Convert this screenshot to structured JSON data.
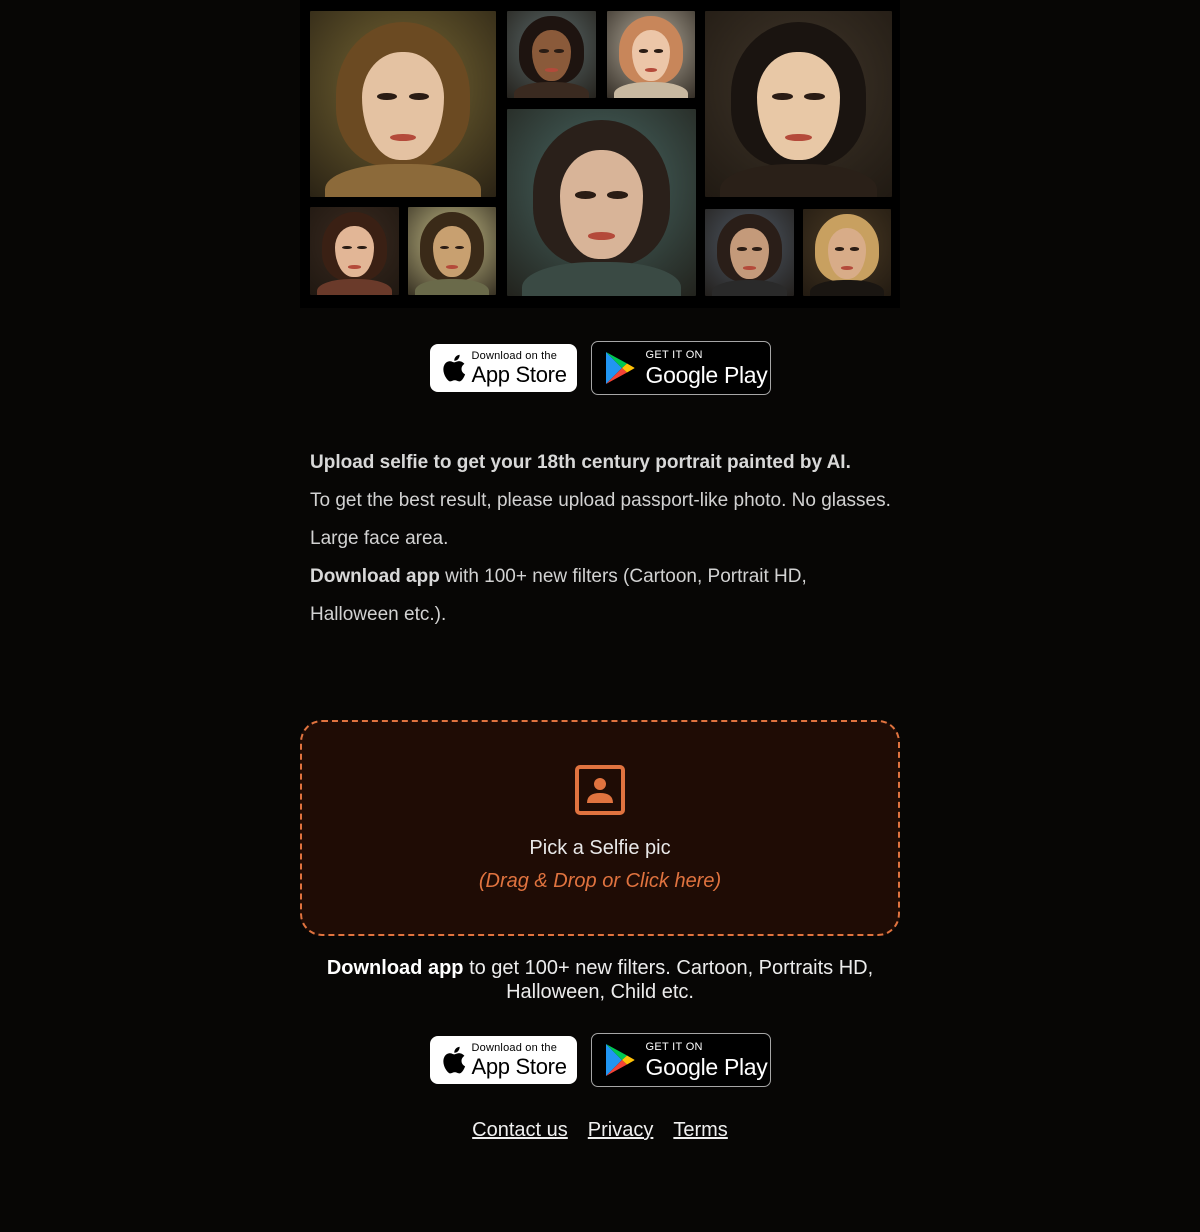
{
  "collage": {
    "portraits": [
      {
        "name": "portrait-woman-auburn-hair",
        "skin": "#e4c2a2",
        "hair": "#6b4a22",
        "bg": "#7a6a35",
        "clothes": "#8c6a3a"
      },
      {
        "name": "portrait-woman-dark-stylized",
        "skin": "#8a5a3a",
        "hair": "#1e1410",
        "bg": "#5c6a6a",
        "clothes": "#3a2a20"
      },
      {
        "name": "portrait-girl-blonde",
        "skin": "#ecc6a8",
        "hair": "#c8865a",
        "bg": "#b8b0a0",
        "clothes": "#c8b8a0"
      },
      {
        "name": "portrait-woman-black-hair",
        "skin": "#e8c8a6",
        "hair": "#1a1410",
        "bg": "#40362a",
        "clothes": "#2a2018"
      },
      {
        "name": "portrait-girl-teal-background",
        "skin": "#d8b498",
        "hair": "#2a201a",
        "bg": "#4a6a66",
        "clothes": "#3a4a44"
      },
      {
        "name": "portrait-woman-brunette-updo",
        "skin": "#e2b696",
        "hair": "#3a2014",
        "bg": "#3a2a20",
        "clothes": "#6a3a2a"
      },
      {
        "name": "portrait-woman-bob-hair",
        "skin": "#c8a070",
        "hair": "#3a2a18",
        "bg": "#c8c08a",
        "clothes": "#6a6a4a"
      },
      {
        "name": "portrait-man-bearded",
        "skin": "#c49a7a",
        "hair": "#2a1e18",
        "bg": "#505a66",
        "clothes": "#2a2a2a"
      },
      {
        "name": "portrait-man-blond",
        "skin": "#d8ac88",
        "hair": "#c8a060",
        "bg": "#4a3a24",
        "clothes": "#1a1612"
      }
    ]
  },
  "badges": {
    "apple_small": "Download on the",
    "apple_big": "App Store",
    "google_small": "GET IT ON",
    "google_big": "Google Play"
  },
  "description": {
    "heading": "Upload selfie to get your 18th century portrait painted by AI.",
    "tip": "To get the best result, please upload passport-like photo. No glasses. Large face area.",
    "download_bold": "Download app",
    "download_rest": " with 100+ new filters (Cartoon, Portrait HD, Halloween etc.)."
  },
  "upload": {
    "label": "Pick a Selfie pic",
    "hint": "(Drag & Drop or Click here)",
    "accent": "#e0733f"
  },
  "promo": {
    "bold": "Download app",
    "rest": " to get 100+ new filters. Cartoon, Portraits HD, Halloween, Child etc."
  },
  "footer": {
    "contact": "Contact us",
    "privacy": "Privacy",
    "terms": "Terms"
  }
}
